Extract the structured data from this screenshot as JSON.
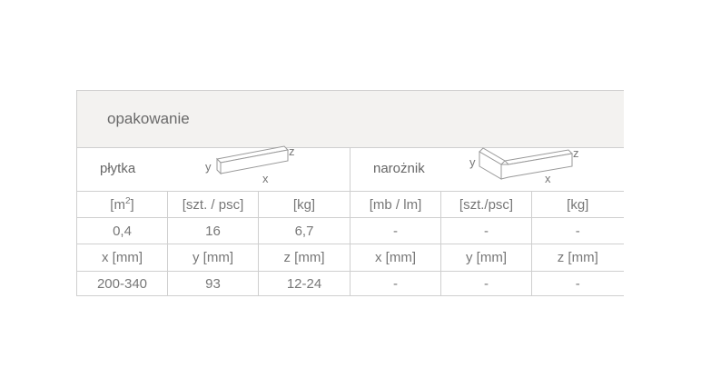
{
  "header": {
    "title": "opakowanie"
  },
  "tile": {
    "label": "płytka",
    "axes": {
      "x": "x",
      "y": "y",
      "z": "z"
    }
  },
  "corner": {
    "label": "narożnik",
    "axes": {
      "x": "x",
      "y": "y",
      "z": "z"
    }
  },
  "units_row": {
    "c1_base": "[m",
    "c1_sup": "2",
    "c1_end": "]",
    "c2": "[szt. / psc]",
    "c3": "[kg]",
    "c4": "[mb / lm]",
    "c5": "[szt./psc]",
    "c6": "[kg]"
  },
  "values_row": [
    "0,4",
    "16",
    "6,7",
    "-",
    "-",
    "-"
  ],
  "dims_row": [
    "x [mm]",
    "y [mm]",
    "z [mm]",
    "x [mm]",
    "y [mm]",
    "z [mm]"
  ],
  "dimvals_row": [
    "200-340",
    "93",
    "12-24",
    "-",
    "-",
    "-"
  ],
  "colors": {
    "header_bg": "#f3f2f0",
    "border": "#cfcfcf",
    "text": "#777777"
  }
}
